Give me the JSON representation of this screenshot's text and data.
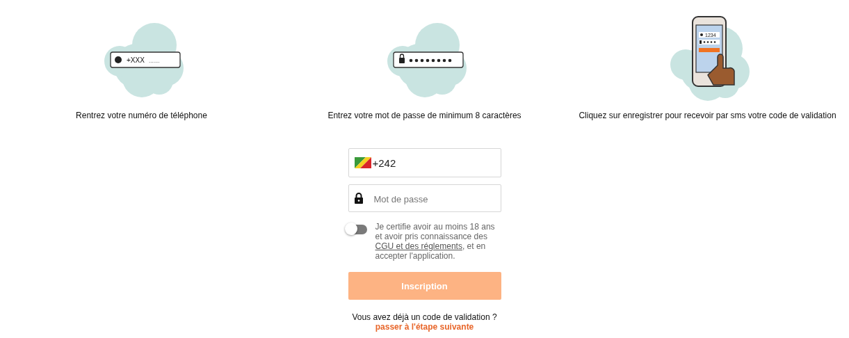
{
  "steps": [
    {
      "kind": "phone",
      "illustration_texts": [
        "+XXX",
        "......."
      ],
      "caption": "Rentrez votre numéro de téléphone"
    },
    {
      "kind": "password",
      "caption": "Entrez votre mot de passe de minimum 8 caractères"
    },
    {
      "kind": "sms",
      "illustration_texts": [
        "1234"
      ],
      "caption": "Cliquez sur enregistrer pour recevoir par sms votre code de validation"
    }
  ],
  "form": {
    "phone": {
      "value": "+242"
    },
    "password": {
      "placeholder": "Mot de passe"
    },
    "consent": {
      "on": false,
      "text_before": "Je certifie avoir au moins 18 ans et avoir pris connaissance des",
      "link": "CGU et des réglements",
      "text_after": ", et en accepter l'application."
    },
    "submit": {
      "label": "Inscription",
      "disabled": true
    },
    "footer": {
      "question": "Vous avez déjà un code de validation ?",
      "link": "passer à l'étape suivante"
    }
  }
}
